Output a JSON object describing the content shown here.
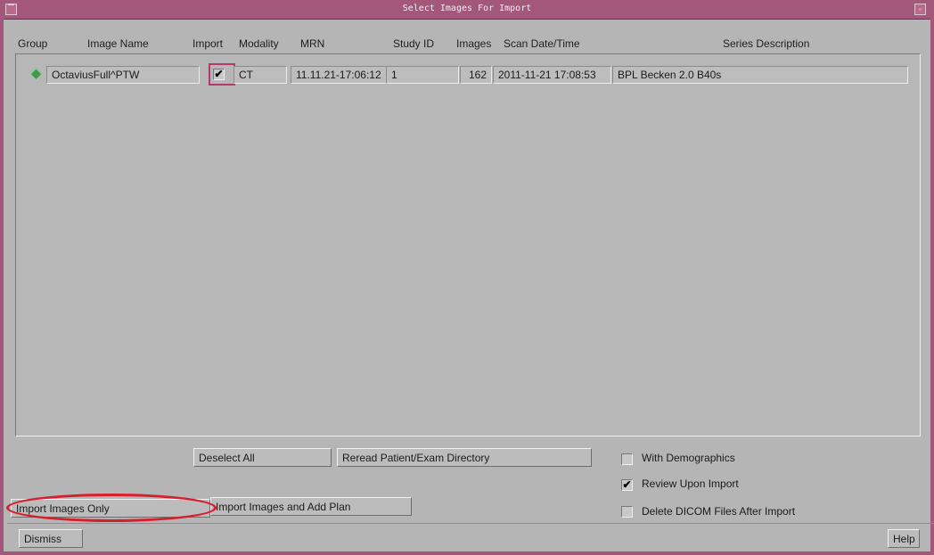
{
  "window": {
    "title": "Select Images For Import"
  },
  "columns": {
    "group": "Group",
    "image_name": "Image Name",
    "import": "Import",
    "modality": "Modality",
    "mrn": "MRN",
    "study_id": "Study ID",
    "images": "Images",
    "scan_datetime": "Scan Date/Time",
    "series_description": "Series Description"
  },
  "rows": [
    {
      "image_name": "OctaviusFull^PTW",
      "import_checked": true,
      "import_mark": "✔",
      "modality": "CT",
      "mrn": "11.11.21-17:06:12",
      "study_id": "1",
      "images": "162",
      "scan_datetime": "2011-11-21 17:08:53",
      "series_description": "BPL Becken 2.0 B40s"
    }
  ],
  "buttons": {
    "deselect_all": "Deselect All",
    "reread": "Reread Patient/Exam Directory",
    "import_only": "Import Images Only",
    "import_add_plan": "Import Images and Add Plan",
    "dismiss": "Dismiss",
    "help": "Help"
  },
  "options": {
    "with_demographics": {
      "label": "With Demographics",
      "checked": false,
      "mark": ""
    },
    "review_upon_import": {
      "label": "Review Upon Import",
      "checked": true,
      "mark": "✔"
    },
    "delete_dicom": {
      "label": "Delete DICOM Files After Import",
      "checked": false,
      "mark": ""
    }
  },
  "colors": {
    "titlebar": "#a3577a",
    "highlight_ellipse": "#d81d2c",
    "group_icon": "#3f9a4a"
  }
}
